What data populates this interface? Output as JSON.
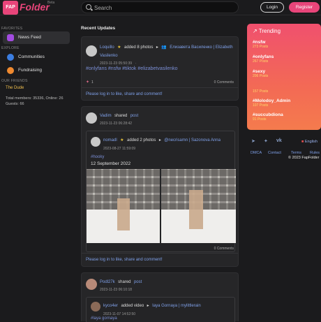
{
  "header": {
    "logo_badge": "FAP",
    "logo_text": "Folder",
    "logo_beta": "Beta",
    "search_placeholder": "Search",
    "login_label": "Login",
    "register_label": "Register"
  },
  "sidebar": {
    "favorites_heading": "FAVORITES",
    "news_feed": "News Feed",
    "explore_heading": "EXPLORE",
    "communities": "Communities",
    "fundraising": "Fundraising",
    "friends_heading": "OUR FRIENDS",
    "friend_name": "The    Dude",
    "stats": "Total members: 35336, Online: 26 Guests: 66"
  },
  "feed": {
    "title": "Recent Updates",
    "posts": [
      {
        "user": "Loquillo",
        "action": "added 8 photos",
        "target": "Елизавета Василенко | Elizabeth Vasilenko",
        "time": "2023-11-23 05:50:39",
        "hashtags": "#onlyfans #nsfw #tiktok #elizabetvasilenko",
        "likes": "1",
        "comments": "0 Comments",
        "cta": "Please log in to like, share and comment!"
      },
      {
        "user": "Vadim",
        "action": "shared",
        "object": "post",
        "time": "2023-11-23 06:28:42",
        "inner_user": "nomadl",
        "inner_action": "added 2 photos",
        "inner_target": "@necrisamn | Sazonova Anna",
        "inner_time": "2023-08-27 11:59:09",
        "inner_tag": "#hooky",
        "inner_date_text": "12 September 2022",
        "comments": "0 Comments",
        "cta": "Please log in to like, share and comment!"
      },
      {
        "user": "Podl27k",
        "action": "shared",
        "object": "post",
        "time": "2023-11-23 06:10:18",
        "inner_user": "kyco4er",
        "inner_action": "added video",
        "inner_target": "Iaya Gornaya | mylittlerain",
        "inner_time": "2023-11-07 14:52:50",
        "inner_tag": "#laya gornaya"
      }
    ]
  },
  "trending": {
    "title": "Trending",
    "items": [
      {
        "tag": "#nsfw",
        "count": "273 Posts"
      },
      {
        "tag": "#onlyfans",
        "count": "267 Posts"
      },
      {
        "tag": "#sexy",
        "count": "206 Posts"
      },
      {
        "tag": "",
        "count": "157 Posts"
      },
      {
        "tag": "#Molodoy_Admin",
        "count": "107 Posts"
      },
      {
        "tag": "#succubdiona",
        "count": "91 Posts"
      }
    ]
  },
  "footer": {
    "language": "English",
    "dmca": "DMCA",
    "contact": "Contact",
    "terms": "Terms",
    "rules": "Rules",
    "copyright": "© 2023 FapFolder"
  },
  "colors": {
    "accent": "#e8457a",
    "link": "#7fa0e8",
    "trending_start": "#f0506e",
    "trending_end": "#f47b4d"
  }
}
